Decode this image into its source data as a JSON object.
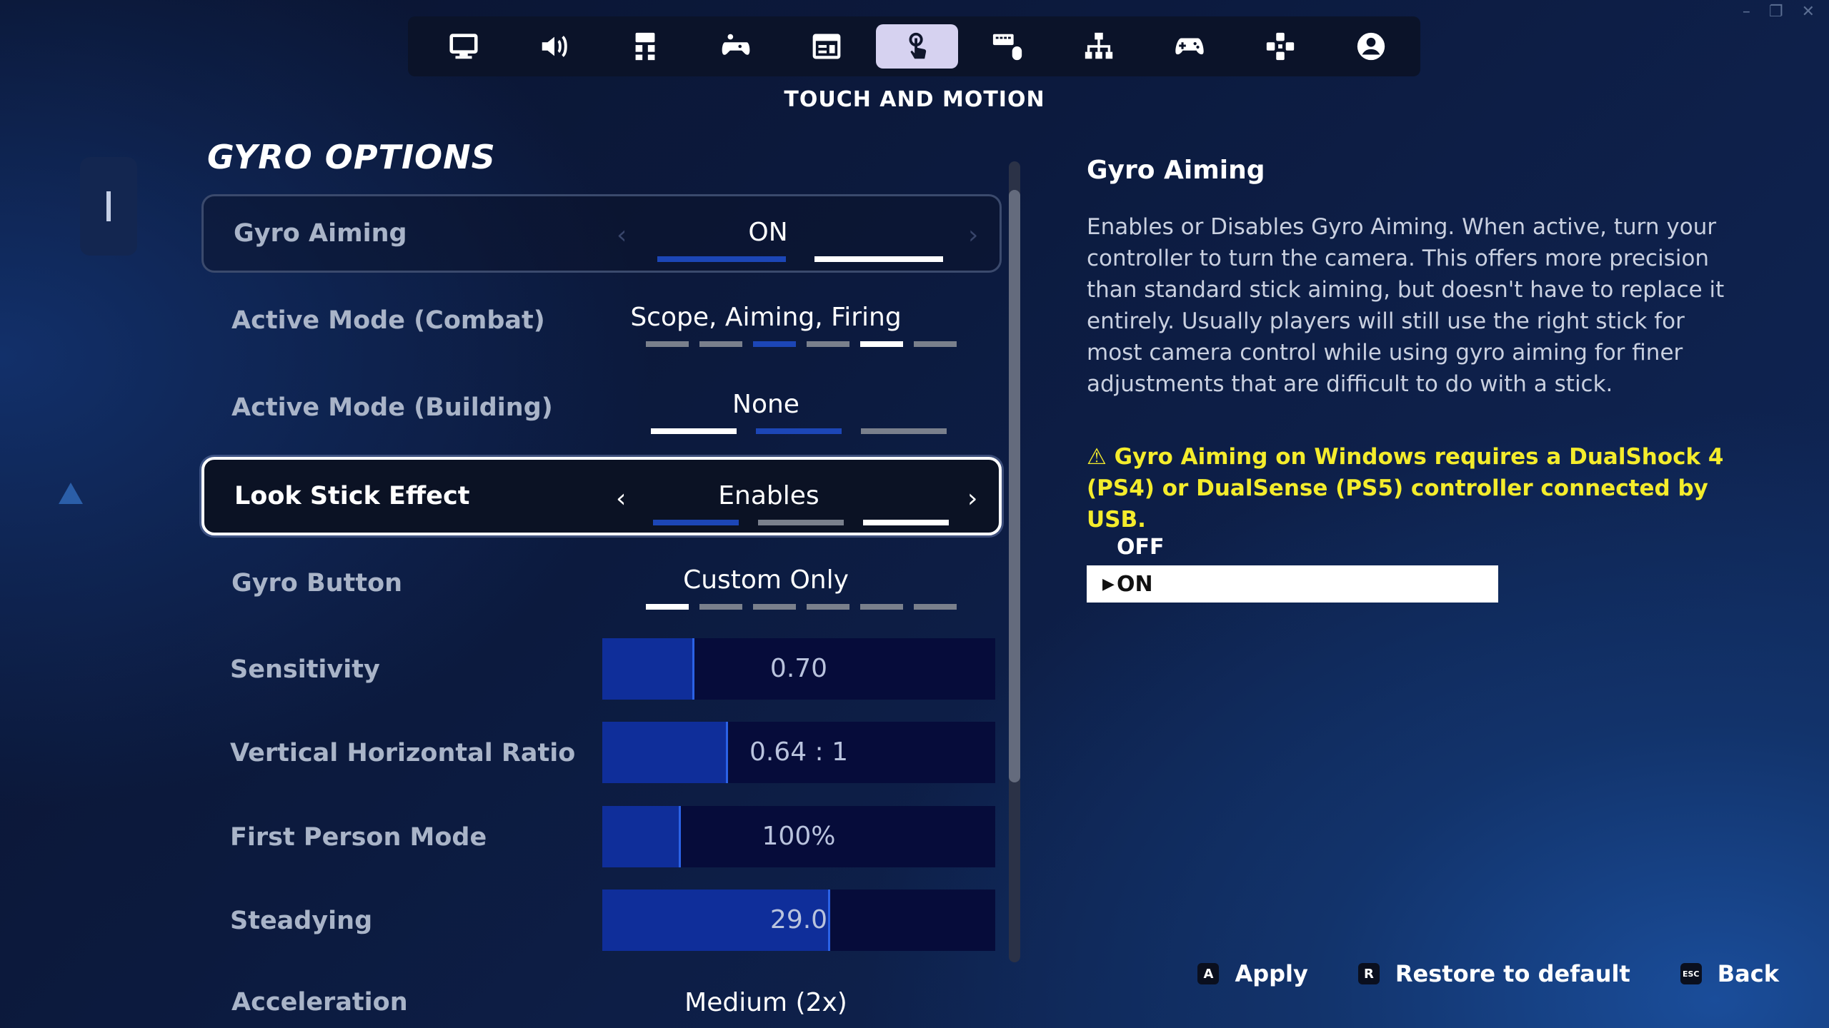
{
  "window_controls": [
    "–",
    "❐",
    "✕"
  ],
  "nav": {
    "tabs": [
      {
        "icon": "monitor-icon"
      },
      {
        "icon": "speaker-icon"
      },
      {
        "icon": "controller-grid-icon"
      },
      {
        "icon": "gamepad-touch-icon"
      },
      {
        "icon": "hud-layout-icon"
      },
      {
        "icon": "touch-hand-icon",
        "active": true
      },
      {
        "icon": "keyboard-mouse-icon"
      },
      {
        "icon": "network-icon"
      },
      {
        "icon": "gamepad-icon"
      },
      {
        "icon": "dpad-icon"
      },
      {
        "icon": "account-icon"
      }
    ],
    "section_title": "TOUCH AND MOTION"
  },
  "panel": {
    "title": "GYRO OPTIONS",
    "options": [
      {
        "label": "Gyro Aiming",
        "value": "ON"
      },
      {
        "label": "Active Mode (Combat)",
        "value": "Scope, Aiming, Firing"
      },
      {
        "label": "Active Mode (Building)",
        "value": "None"
      },
      {
        "label": "Look Stick Effect",
        "value": "Enables"
      },
      {
        "label": "Gyro Button",
        "value": "Custom Only"
      }
    ],
    "sliders": [
      {
        "label": "Sensitivity",
        "value": "0.70",
        "fill": 0.235
      },
      {
        "label": "Vertical Horizontal Ratio",
        "value": "0.64 : 1",
        "fill": 0.32
      },
      {
        "label": "First Person Mode",
        "value": "100%",
        "fill": 0.2
      },
      {
        "label": "Steadying",
        "value": "29.0",
        "fill": 0.58
      }
    ],
    "last_option": {
      "label": "Acceleration",
      "value": "Medium (2x)"
    }
  },
  "detail": {
    "title": "Gyro Aiming",
    "description": "Enables or Disables Gyro Aiming. When active, turn your controller to turn the camera. This offers more precision than standard stick aiming, but doesn't have to replace it entirely. Usually players will still use the right stick for most camera control while using gyro aiming for finer adjustments that are difficult to do with a stick.",
    "warning": "⚠ Gyro Aiming on Windows requires a DualShock 4 (PS4) or DualSense (PS5) controller connected by USB.",
    "choices": [
      {
        "label": "OFF",
        "selected": false
      },
      {
        "label": "ON",
        "selected": true
      }
    ]
  },
  "footer": {
    "apply": {
      "key": "A",
      "label": "Apply"
    },
    "restore": {
      "key": "R",
      "label": "Restore to default"
    },
    "back": {
      "key": "ESC",
      "label": "Back"
    }
  },
  "colors": {
    "accent_blue": "#1c46b6",
    "warning_yellow": "#f4ec2c",
    "active_tab": "#d6d2f0"
  }
}
